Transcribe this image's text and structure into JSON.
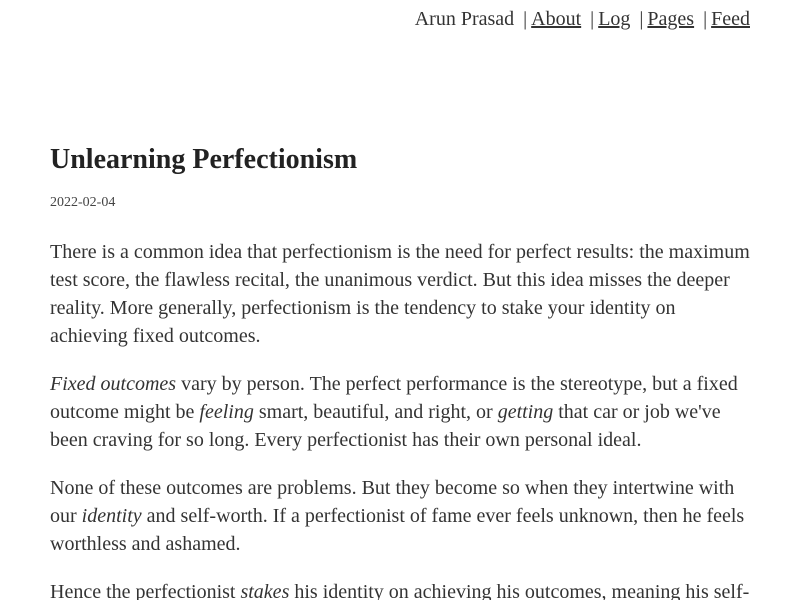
{
  "nav": {
    "author": "Arun Prasad",
    "separator": "|",
    "links": [
      "About",
      "Log",
      "Pages",
      "Feed"
    ]
  },
  "post": {
    "title": "Unlearning Perfectionism",
    "date": "2022-02-04",
    "paragraphs": [
      {
        "text1": "There is a common idea that perfectionism is the need for perfect results: the maximum test score, the flawless recital, the unanimous verdict. But this idea misses the deeper reality. More generally, perfectionism is the tendency to stake your identity on achieving fixed outcomes."
      },
      {
        "em1": "Fixed outcomes",
        "text1": " vary by person. The perfect performance is the stereotype, but a fixed outcome might be ",
        "em2": "feeling",
        "text2": " smart, beautiful, and right, or ",
        "em3": "getting",
        "text3": " that car or job we've been craving for so long. Every perfectionist has their own personal ideal."
      },
      {
        "text1": "None of these outcomes are problems. But they become so when they intertwine with our ",
        "em1": "identity",
        "text2": " and self-worth. If a perfectionist of fame ever feels unknown, then he feels worthless and ashamed."
      },
      {
        "text1": "Hence the perfectionist ",
        "em1": "stakes",
        "text2": " his identity on achieving his outcomes, meaning his self-"
      }
    ]
  }
}
